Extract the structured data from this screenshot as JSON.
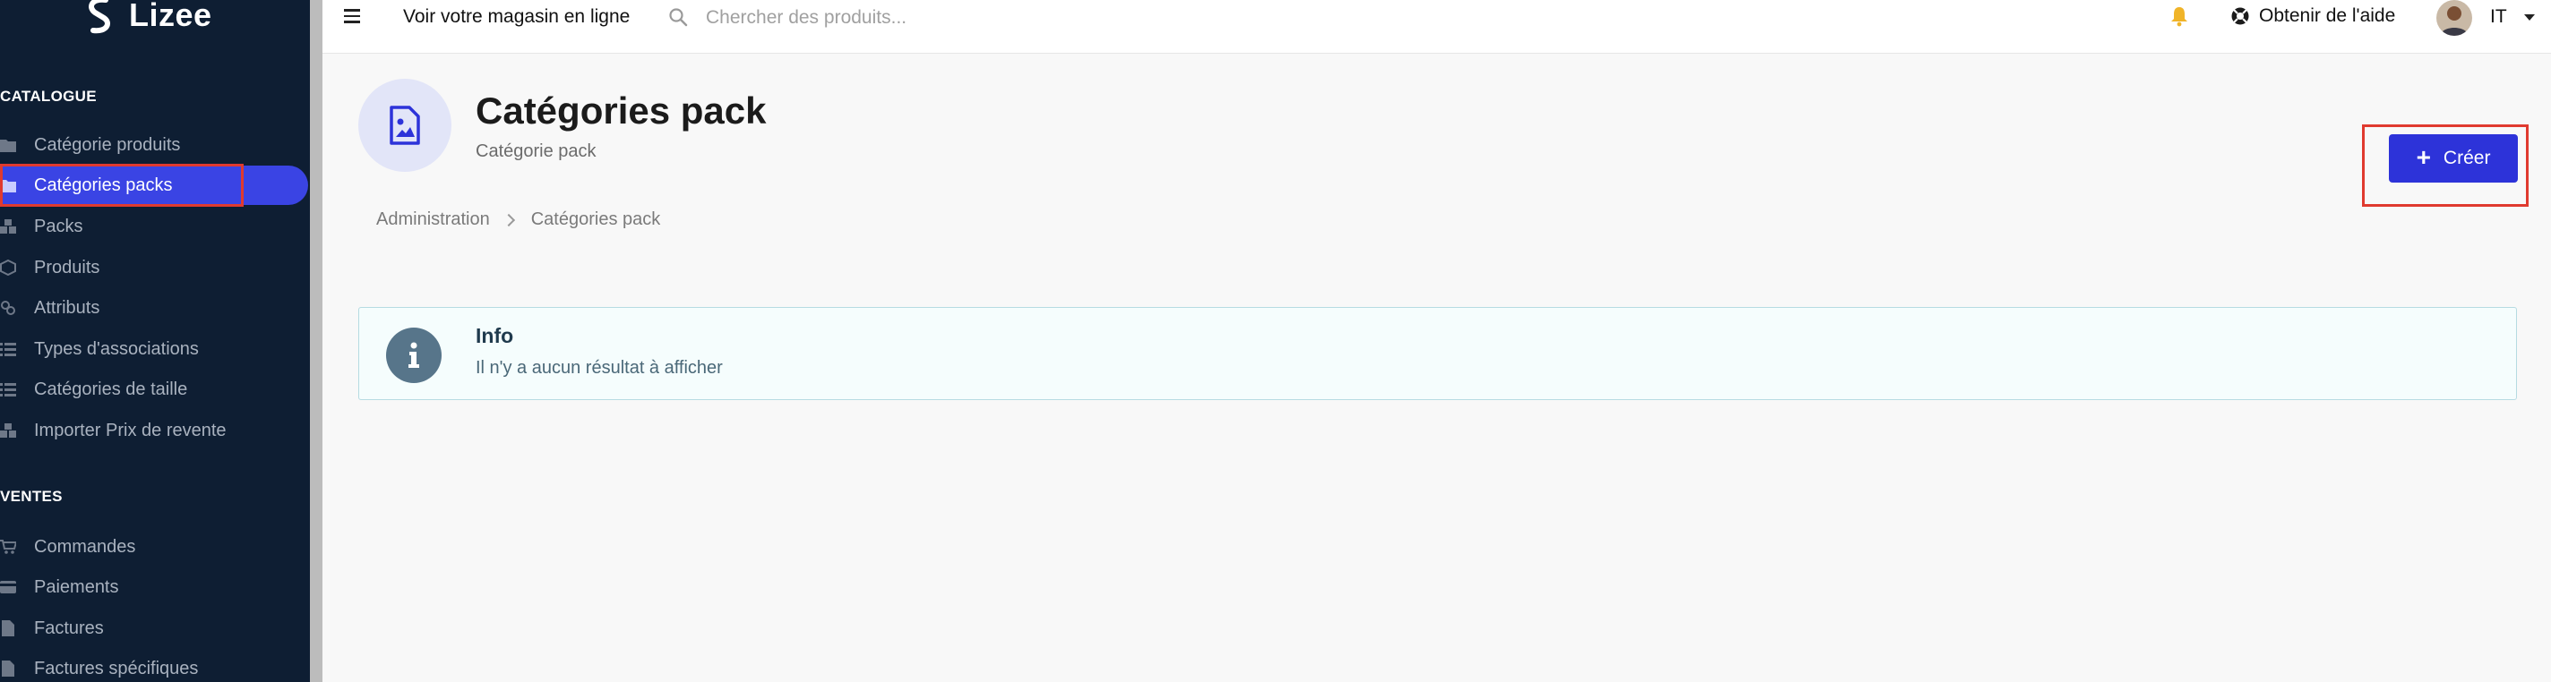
{
  "brand": {
    "name": "Lizee"
  },
  "sidebar": {
    "sections": [
      {
        "title": "CATALOGUE",
        "items": [
          {
            "label": "Catégorie produits",
            "icon": "folder-icon"
          },
          {
            "label": "Catégories packs",
            "icon": "folder-icon",
            "active": true
          },
          {
            "label": "Packs",
            "icon": "boxes-icon"
          },
          {
            "label": "Produits",
            "icon": "cube-icon"
          },
          {
            "label": "Attributs",
            "icon": "cubes-icon"
          },
          {
            "label": "Types d'associations",
            "icon": "list-icon"
          },
          {
            "label": "Catégories de taille",
            "icon": "list-icon"
          },
          {
            "label": "Importer Prix de revente",
            "icon": "boxes-icon"
          }
        ]
      },
      {
        "title": "VENTES",
        "items": [
          {
            "label": "Commandes",
            "icon": "cart-icon"
          },
          {
            "label": "Paiements",
            "icon": "credit-card-icon"
          },
          {
            "label": "Factures",
            "icon": "file-icon"
          },
          {
            "label": "Factures spécifiques",
            "icon": "file-icon"
          }
        ]
      }
    ]
  },
  "topbar": {
    "shop_link": "Voir votre magasin en ligne",
    "search_placeholder": "Chercher des produits...",
    "help_label": "Obtenir de l'aide",
    "user_label": "IT"
  },
  "header": {
    "title": "Catégories pack",
    "subtitle": "Catégorie pack",
    "create_label": "Créer"
  },
  "breadcrumb": [
    "Administration",
    "Catégories pack"
  ],
  "info": {
    "title": "Info",
    "message": "Il n'y a aucun résultat à afficher"
  },
  "colors": {
    "sidebar_bg": "#0e1e33",
    "accent": "#2d33d9",
    "active_item": "#3a44e4",
    "highlight_outline": "#e03a2f",
    "bell": "#f0b429"
  }
}
